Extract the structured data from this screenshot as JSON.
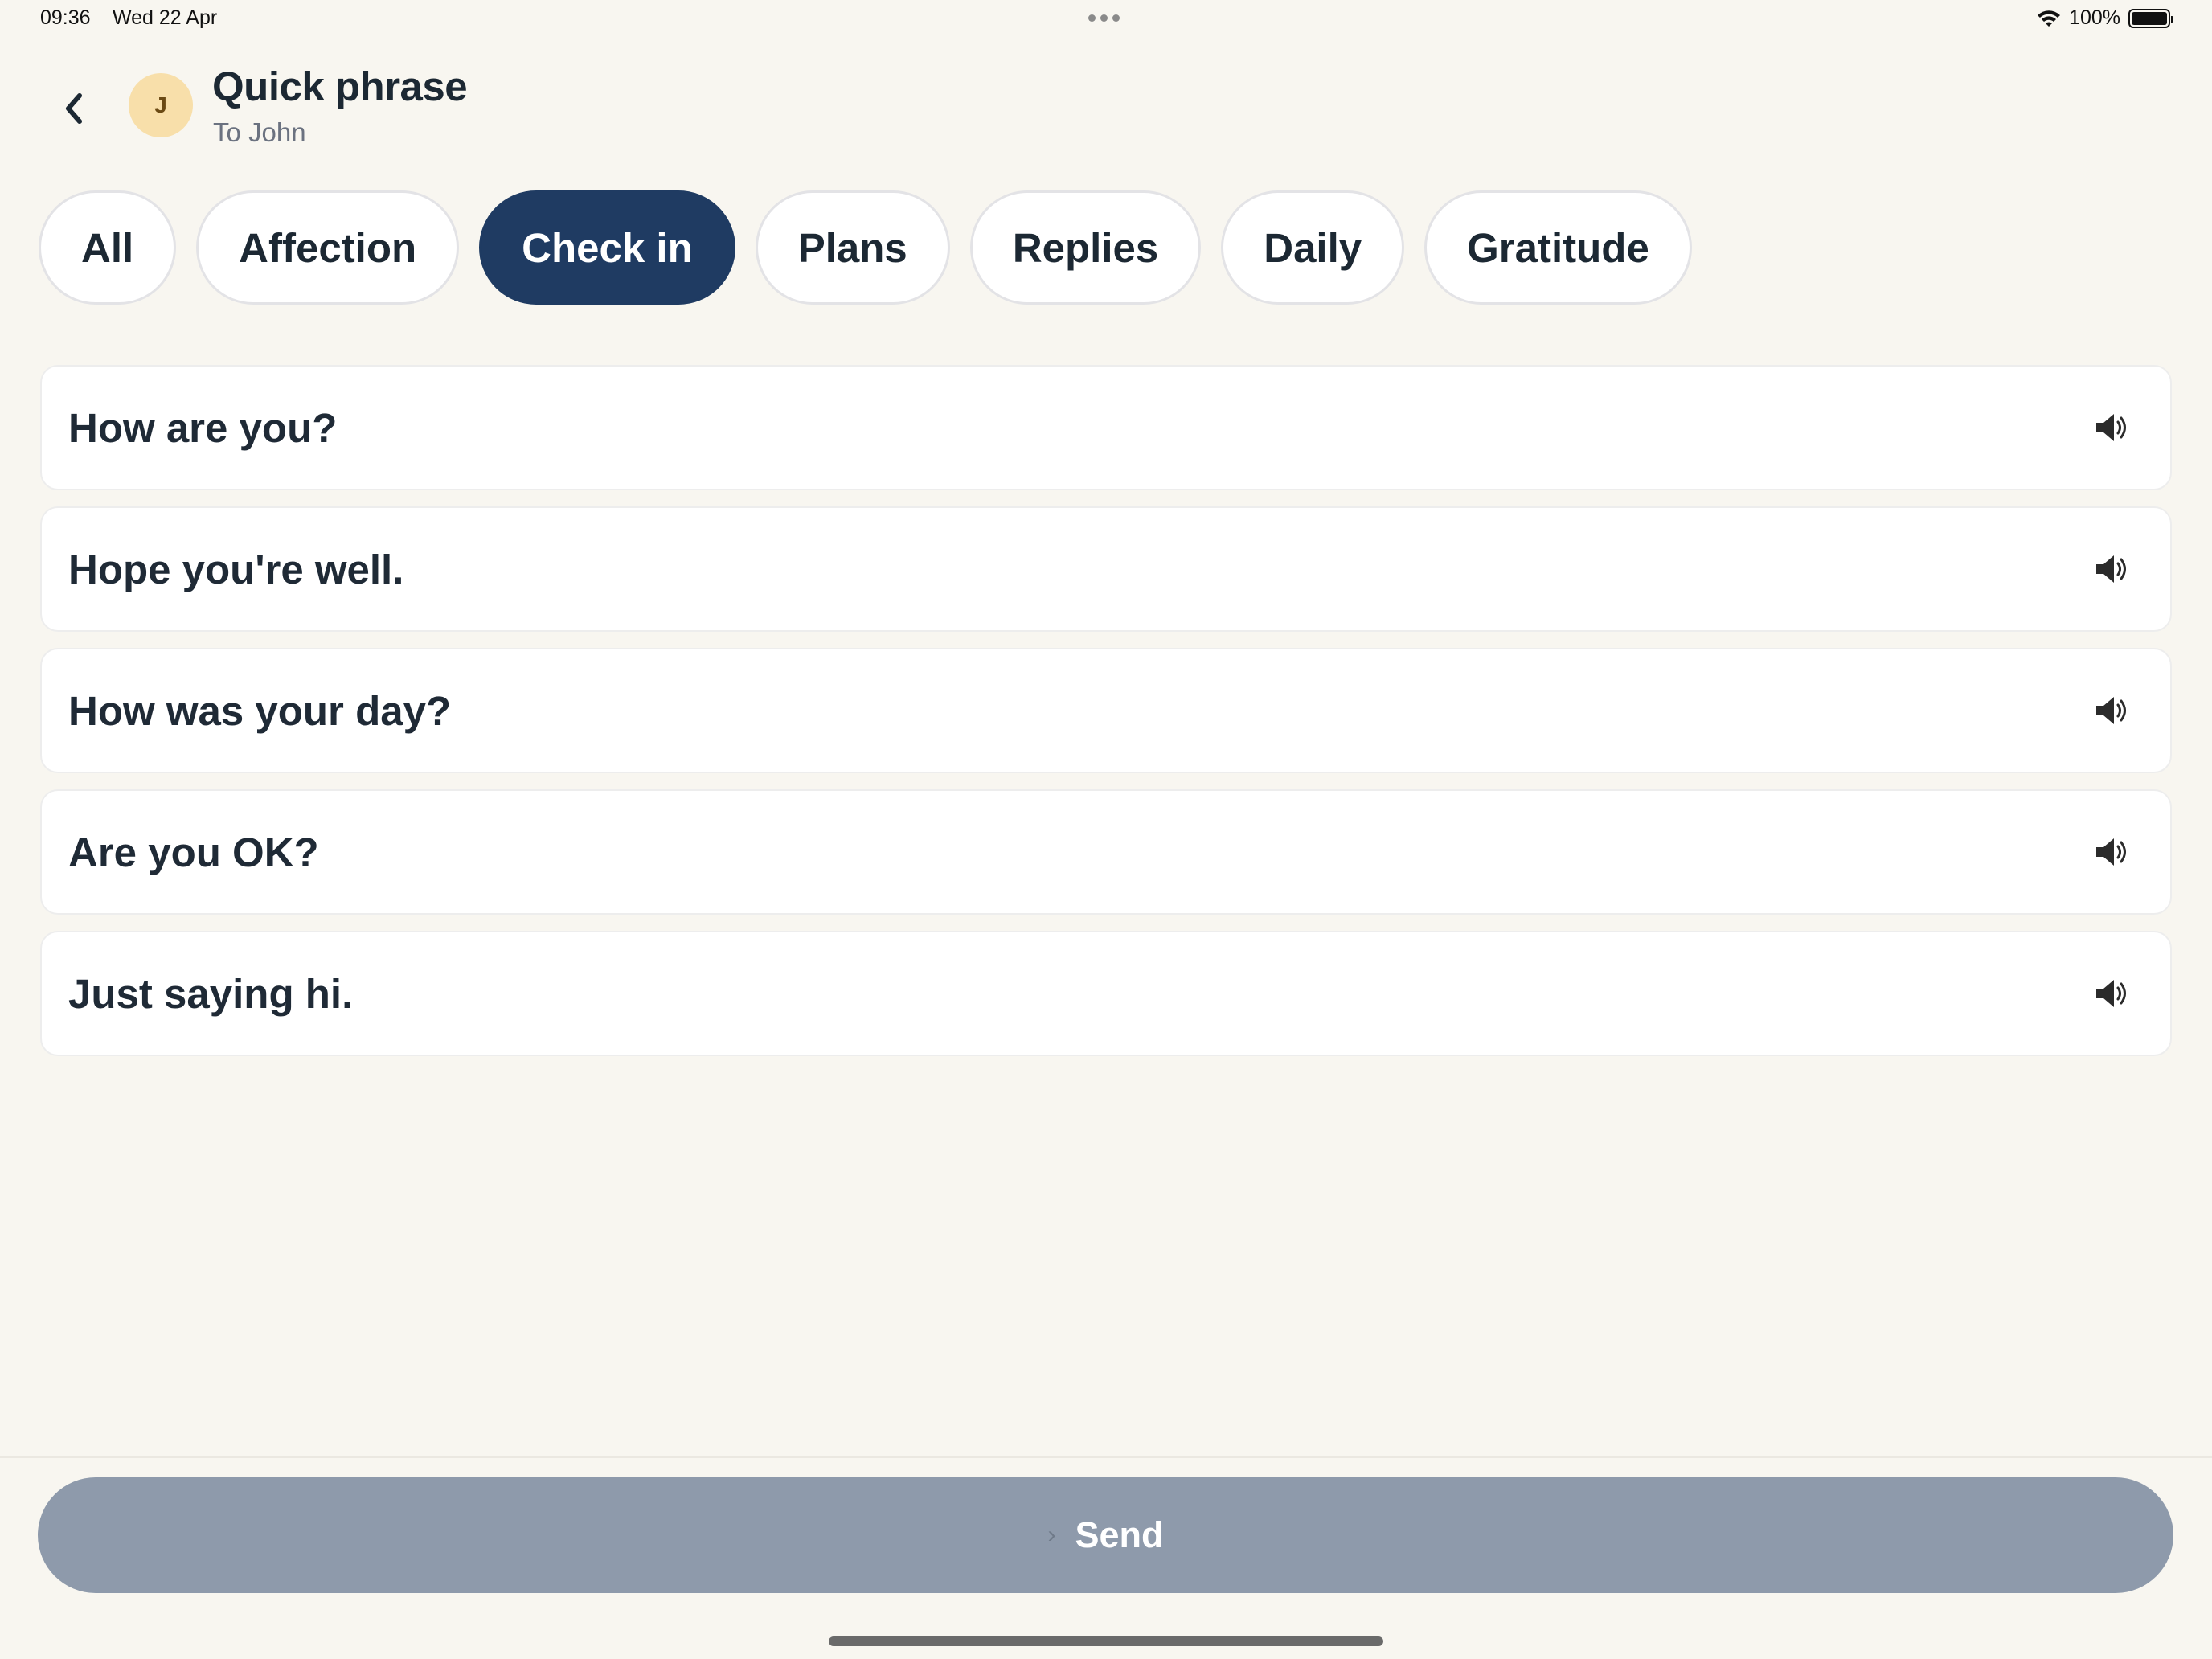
{
  "status_bar": {
    "time": "09:36",
    "date": "Wed 22 Apr",
    "battery": "100%",
    "battery_level": 1.0,
    "wifi_icon": "wifi-icon",
    "battery_icon": "battery-icon"
  },
  "header": {
    "back_icon": "chevron-left-icon",
    "avatar_initial": "J",
    "title": "Quick phrase",
    "subtitle": "To John"
  },
  "tabs": [
    {
      "label": "All",
      "active": false
    },
    {
      "label": "Affection",
      "active": false
    },
    {
      "label": "Check in",
      "active": true
    },
    {
      "label": "Plans",
      "active": false
    },
    {
      "label": "Replies",
      "active": false
    },
    {
      "label": "Daily",
      "active": false
    },
    {
      "label": "Gratitude",
      "active": false
    }
  ],
  "phrases": [
    {
      "text": "How are you?",
      "icon": "speaker-icon"
    },
    {
      "text": "Hope you're well.",
      "icon": "speaker-icon"
    },
    {
      "text": "How was your day?",
      "icon": "speaker-icon"
    },
    {
      "text": "Are you OK?",
      "icon": "speaker-icon"
    },
    {
      "text": "Just saying hi.",
      "icon": "speaker-icon"
    }
  ],
  "send": {
    "label": "Send",
    "chevron": "›",
    "disabled": true
  },
  "colors": {
    "background": "#f8f6f0",
    "accent": "#1f3b62",
    "avatar_bg": "#f8dfaa",
    "send_disabled": "#8e9aab"
  }
}
